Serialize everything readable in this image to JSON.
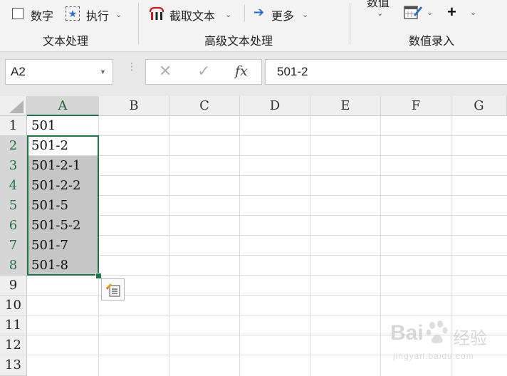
{
  "ribbon": {
    "text_group": {
      "digits_label": "数字",
      "execute_label": "执行",
      "label": "文本处理"
    },
    "advanced_group": {
      "extract_label": "截取文本",
      "more_label": "更多",
      "label": "高级文本处理"
    },
    "number_group": {
      "value_label": "数值",
      "label": "数值录入"
    }
  },
  "formula_bar": {
    "name_box": "A2",
    "fx": "fx",
    "formula": "501-2"
  },
  "columns": [
    "A",
    "B",
    "C",
    "D",
    "E",
    "F",
    "G"
  ],
  "rows": [
    "1",
    "2",
    "3",
    "4",
    "5",
    "6",
    "7",
    "8",
    "9",
    "10",
    "11",
    "12",
    "13"
  ],
  "cells_A": [
    "501",
    "501-2",
    "501-2-1",
    "501-2-2",
    "501-5",
    "501-5-2",
    "501-7",
    "501-8"
  ],
  "watermark": {
    "brand": "Bai",
    "suffix": "经验",
    "url": "jingyan.baidu.com"
  }
}
